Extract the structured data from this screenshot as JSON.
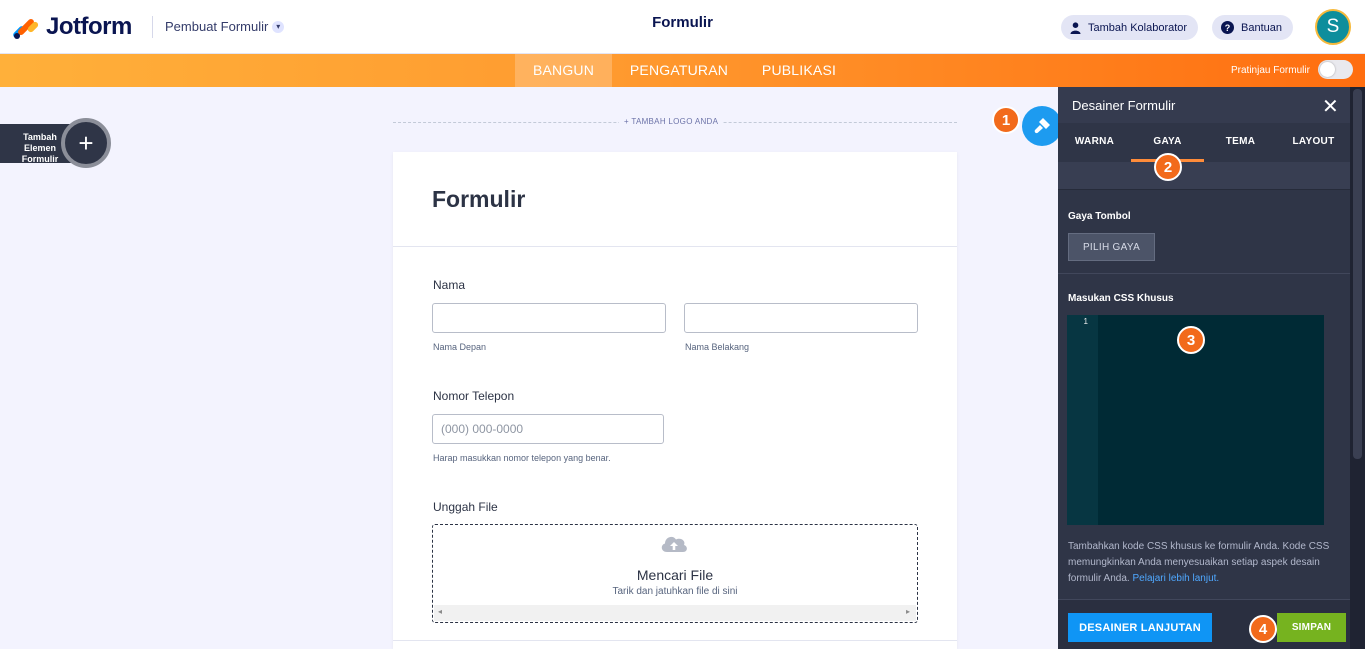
{
  "header": {
    "brand": "Jotform",
    "builder_label": "Pembuat Formulir",
    "form_title": "Formulir",
    "collaborator_label": "Tambah Kolaborator",
    "help_label": "Bantuan",
    "avatar_letter": "S"
  },
  "nav": {
    "tabs": [
      {
        "label": "BANGUN",
        "active": true
      },
      {
        "label": "PENGATURAN",
        "active": false
      },
      {
        "label": "PUBLIKASI",
        "active": false
      }
    ],
    "preview_label": "Pratinjau Formulir",
    "preview_enabled": false
  },
  "left": {
    "add_element_label": "Tambah Elemen Formulir"
  },
  "form": {
    "add_logo_label": "+ TAMBAH LOGO ANDA",
    "title": "Formulir",
    "name_label": "Nama",
    "first_name_sub": "Nama Depan",
    "last_name_sub": "Nama Belakang",
    "phone_label": "Nomor Telepon",
    "phone_placeholder": "(000) 000-0000",
    "phone_sub": "Harap masukkan nomor telepon yang benar.",
    "upload_label": "Unggah File",
    "upload_title": "Mencari File",
    "upload_sub": "Tarik dan jatuhkan file di sini"
  },
  "badges": [
    "1",
    "2",
    "3",
    "4"
  ],
  "panel": {
    "title": "Desainer Formulir",
    "tabs": [
      "WARNA",
      "GAYA",
      "TEMA",
      "LAYOUT"
    ],
    "active_tab": "GAYA",
    "button_style_label": "Gaya Tombol",
    "pick_style_label": "PILIH GAYA",
    "custom_css_label": "Masukan CSS Khusus",
    "css_line_number": "1",
    "help_text": "Tambahkan kode CSS khusus ke formulir Anda. Kode CSS memungkinkan Anda menyesuaikan setiap aspek desain formulir Anda.",
    "learn_more": "Pelajari lebih lanjut.",
    "advanced_designer_label": "DESAINER LANJUTAN",
    "save_label": "SIMPAN"
  },
  "colors": {
    "accent_orange": "#ff6e10",
    "designer_blue": "#1d9bf0",
    "panel_bg": "#2f3547",
    "save_green": "#76b31f",
    "badge_orange": "#f26a1b"
  }
}
